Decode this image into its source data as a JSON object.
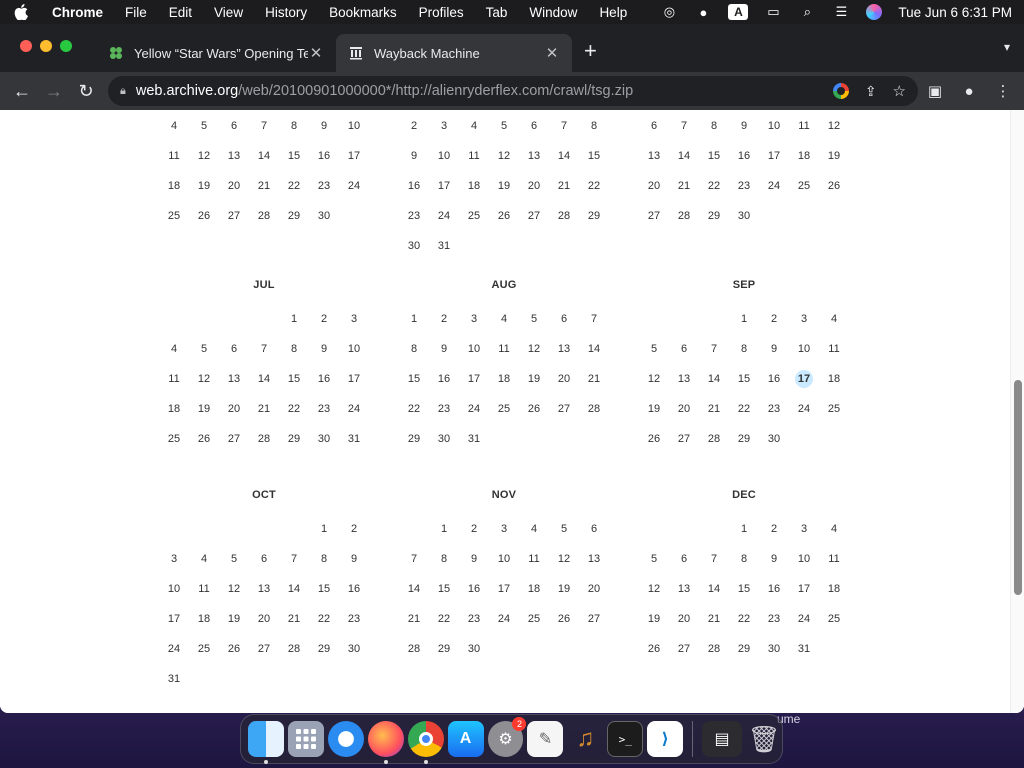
{
  "menubar": {
    "app": "Chrome",
    "items": [
      "File",
      "Edit",
      "View",
      "History",
      "Bookmarks",
      "Profiles",
      "Tab",
      "Window",
      "Help"
    ],
    "keyboard_indicator": "A",
    "clock": "Tue Jun 6  6:31 PM"
  },
  "tabs": [
    {
      "title": "Yellow “Star Wars” Opening Te",
      "icon": "clover-icon",
      "active": false
    },
    {
      "title": "Wayback Machine",
      "icon": "archive-icon",
      "active": true
    }
  ],
  "address": {
    "host": "web.archive.org",
    "path": "/web/20100901000000*/http://alienryderflex.com/crawl/tsg.zip"
  },
  "highlight_day": {
    "month": "SEP",
    "day": 17,
    "color": "#c9eaff"
  },
  "months": [
    {
      "name": "",
      "days": [
        "4",
        "5",
        "6",
        "7",
        "8",
        "9",
        "10",
        "11",
        "12",
        "13",
        "14",
        "15",
        "16",
        "17",
        "18",
        "19",
        "20",
        "21",
        "22",
        "23",
        "24",
        "25",
        "26",
        "27",
        "28",
        "29",
        "30"
      ],
      "offset": 0
    },
    {
      "name": "",
      "days": [
        "2",
        "3",
        "4",
        "5",
        "6",
        "7",
        "8",
        "9",
        "10",
        "11",
        "12",
        "13",
        "14",
        "15",
        "16",
        "17",
        "18",
        "19",
        "20",
        "21",
        "22",
        "23",
        "24",
        "25",
        "26",
        "27",
        "28",
        "29",
        "30",
        "31"
      ],
      "offset": 0
    },
    {
      "name": "",
      "days": [
        "6",
        "7",
        "8",
        "9",
        "10",
        "11",
        "12",
        "13",
        "14",
        "15",
        "16",
        "17",
        "18",
        "19",
        "20",
        "21",
        "22",
        "23",
        "24",
        "25",
        "26",
        "27",
        "28",
        "29",
        "30"
      ],
      "offset": 0
    },
    {
      "name": "JUL",
      "days": [
        "1",
        "2",
        "3",
        "4",
        "5",
        "6",
        "7",
        "8",
        "9",
        "10",
        "11",
        "12",
        "13",
        "14",
        "15",
        "16",
        "17",
        "18",
        "19",
        "20",
        "21",
        "22",
        "23",
        "24",
        "25",
        "26",
        "27",
        "28",
        "29",
        "30",
        "31"
      ],
      "offset": 4
    },
    {
      "name": "AUG",
      "days": [
        "1",
        "2",
        "3",
        "4",
        "5",
        "6",
        "7",
        "8",
        "9",
        "10",
        "11",
        "12",
        "13",
        "14",
        "15",
        "16",
        "17",
        "18",
        "19",
        "20",
        "21",
        "22",
        "23",
        "24",
        "25",
        "26",
        "27",
        "28",
        "29",
        "30",
        "31"
      ],
      "offset": 0
    },
    {
      "name": "SEP",
      "days": [
        "1",
        "2",
        "3",
        "4",
        "5",
        "6",
        "7",
        "8",
        "9",
        "10",
        "11",
        "12",
        "13",
        "14",
        "15",
        "16",
        "17",
        "18",
        "19",
        "20",
        "21",
        "22",
        "23",
        "24",
        "25",
        "26",
        "27",
        "28",
        "29",
        "30"
      ],
      "offset": 3
    },
    {
      "name": "OCT",
      "days": [
        "1",
        "2",
        "3",
        "4",
        "5",
        "6",
        "7",
        "8",
        "9",
        "10",
        "11",
        "12",
        "13",
        "14",
        "15",
        "16",
        "17",
        "18",
        "19",
        "20",
        "21",
        "22",
        "23",
        "24",
        "25",
        "26",
        "27",
        "28",
        "29",
        "30",
        "31"
      ],
      "offset": 5
    },
    {
      "name": "NOV",
      "days": [
        "1",
        "2",
        "3",
        "4",
        "5",
        "6",
        "7",
        "8",
        "9",
        "10",
        "11",
        "12",
        "13",
        "14",
        "15",
        "16",
        "17",
        "18",
        "19",
        "20",
        "21",
        "22",
        "23",
        "24",
        "25",
        "26",
        "27",
        "28",
        "29",
        "30"
      ],
      "offset": 1
    },
    {
      "name": "DEC",
      "days": [
        "1",
        "2",
        "3",
        "4",
        "5",
        "6",
        "7",
        "8",
        "9",
        "10",
        "11",
        "12",
        "13",
        "14",
        "15",
        "16",
        "17",
        "18",
        "19",
        "20",
        "21",
        "22",
        "23",
        "24",
        "25",
        "26",
        "27",
        "28",
        "29",
        "30",
        "31"
      ],
      "offset": 3
    }
  ],
  "dock": {
    "apps": [
      "finder",
      "launchpad",
      "safari",
      "firefox",
      "chrome",
      "app-store",
      "system-settings",
      "textedit",
      "garageband",
      "terminal",
      "vscode"
    ],
    "settings_badge": "2",
    "desktop_text": "ume"
  }
}
